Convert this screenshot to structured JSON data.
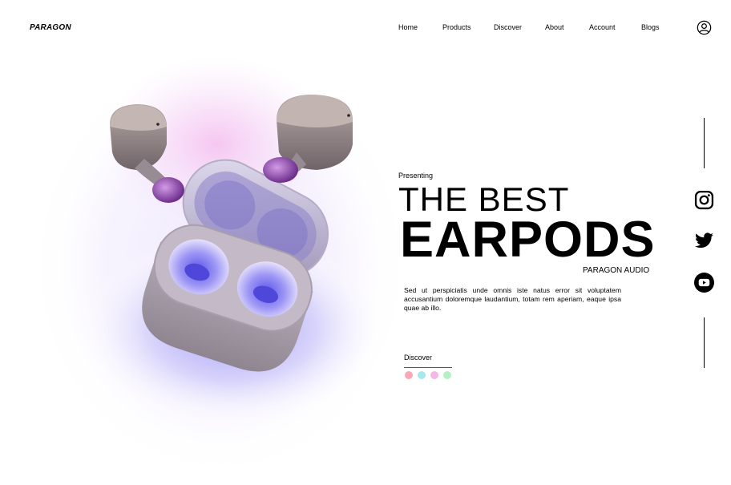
{
  "brand": {
    "logo": "PARAGON"
  },
  "nav": {
    "items": [
      {
        "label": "Home"
      },
      {
        "label": "Products"
      },
      {
        "label": "Discover"
      },
      {
        "label": "About"
      },
      {
        "label": "Account"
      },
      {
        "label": "Blogs"
      }
    ],
    "account_icon": "user-circle-icon"
  },
  "hero": {
    "image": "wireless-earbuds-with-open-charging-case",
    "presenting": "Presenting",
    "title_line1": "THE BEST",
    "title_line2": "EARPODS",
    "subbrand": "PARAGON AUDIO",
    "description": "Sed ut perspiciatis unde omnis iste natus error sit voluptatem accusantium doloremque laudantium, totam rem aperiam, eaque ipsa quae ab illo.",
    "discover_label": "Discover",
    "color_options": [
      "#f9a8b4",
      "#a8e6f0",
      "#f5b8e6",
      "#b4f0c4"
    ]
  },
  "social": {
    "icons": [
      "instagram-icon",
      "twitter-icon",
      "youtube-icon"
    ]
  },
  "colors": {
    "accent_purple": "#6b5cf0",
    "glow_pink": "#f6c7f0",
    "text": "#000000",
    "background": "#ffffff"
  }
}
